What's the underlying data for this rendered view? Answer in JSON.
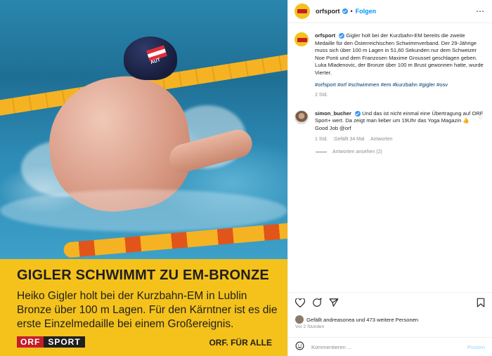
{
  "media": {
    "headline": "GIGLER SCHWIMMT ZU EM-BRONZE",
    "body": "Heiko Gigler holt bei der Kurzbahn-EM in Lublin Bronze über 100 m Lagen. Für den Kärntner ist es die erste Einzelmedaille bei einem Großereignis.",
    "logo_orf": "ORF",
    "logo_sport": "SPORT",
    "tagline": "ORF. FÜR ALLE",
    "cap_text": "AUT"
  },
  "header": {
    "username": "orfsport",
    "follow_label": "Folgen",
    "more_icon": "⋯"
  },
  "caption": {
    "username": "orfsport",
    "text": "Gigler holt bei der Kurzbahn-EM bereits die zweite Medaille für den Österreichischen Schwimmverband. Der 29-Jährige muss sich über 100 m Lagen in 51,60 Sekunden nur dem Schweizer Noe Ponti und dem Franzosen Maxime Grousset geschlagen geben. Luka Mladenovic, der Bronze über 100 m Brust gewonnen hatte, wurde Vierter.",
    "hashtags": "#orfsport #orf #schwimmen #em #kurzbahn #gigler #osv",
    "time": "2 Std."
  },
  "comment": {
    "username": "simon_bucher",
    "text": "Und das ist nicht einmal eine Übertragung auf ORF Sport+ wert. Da zeigt man lieber um 19Uhr das Yoga Magazin 👍 Good Job @orf",
    "time": "1 Std.",
    "likes": "Gefällt 34 Mal",
    "reply_label": "Antworten",
    "view_replies": "Antworten ansehen (2)"
  },
  "actions": {
    "like_icon": "heart-icon",
    "comment_icon": "comment-icon",
    "share_icon": "share-icon",
    "bookmark_icon": "bookmark-icon"
  },
  "likes_text": "Gefällt andreasonea und 473 weitere Personen",
  "post_time": "Vor 2 Stunden",
  "compose": {
    "placeholder": "Kommentieren ...",
    "post_label": "Posten"
  },
  "colors": {
    "banner": "#f4c21b",
    "link": "#0095f6",
    "orf_red": "#c51d2a"
  }
}
